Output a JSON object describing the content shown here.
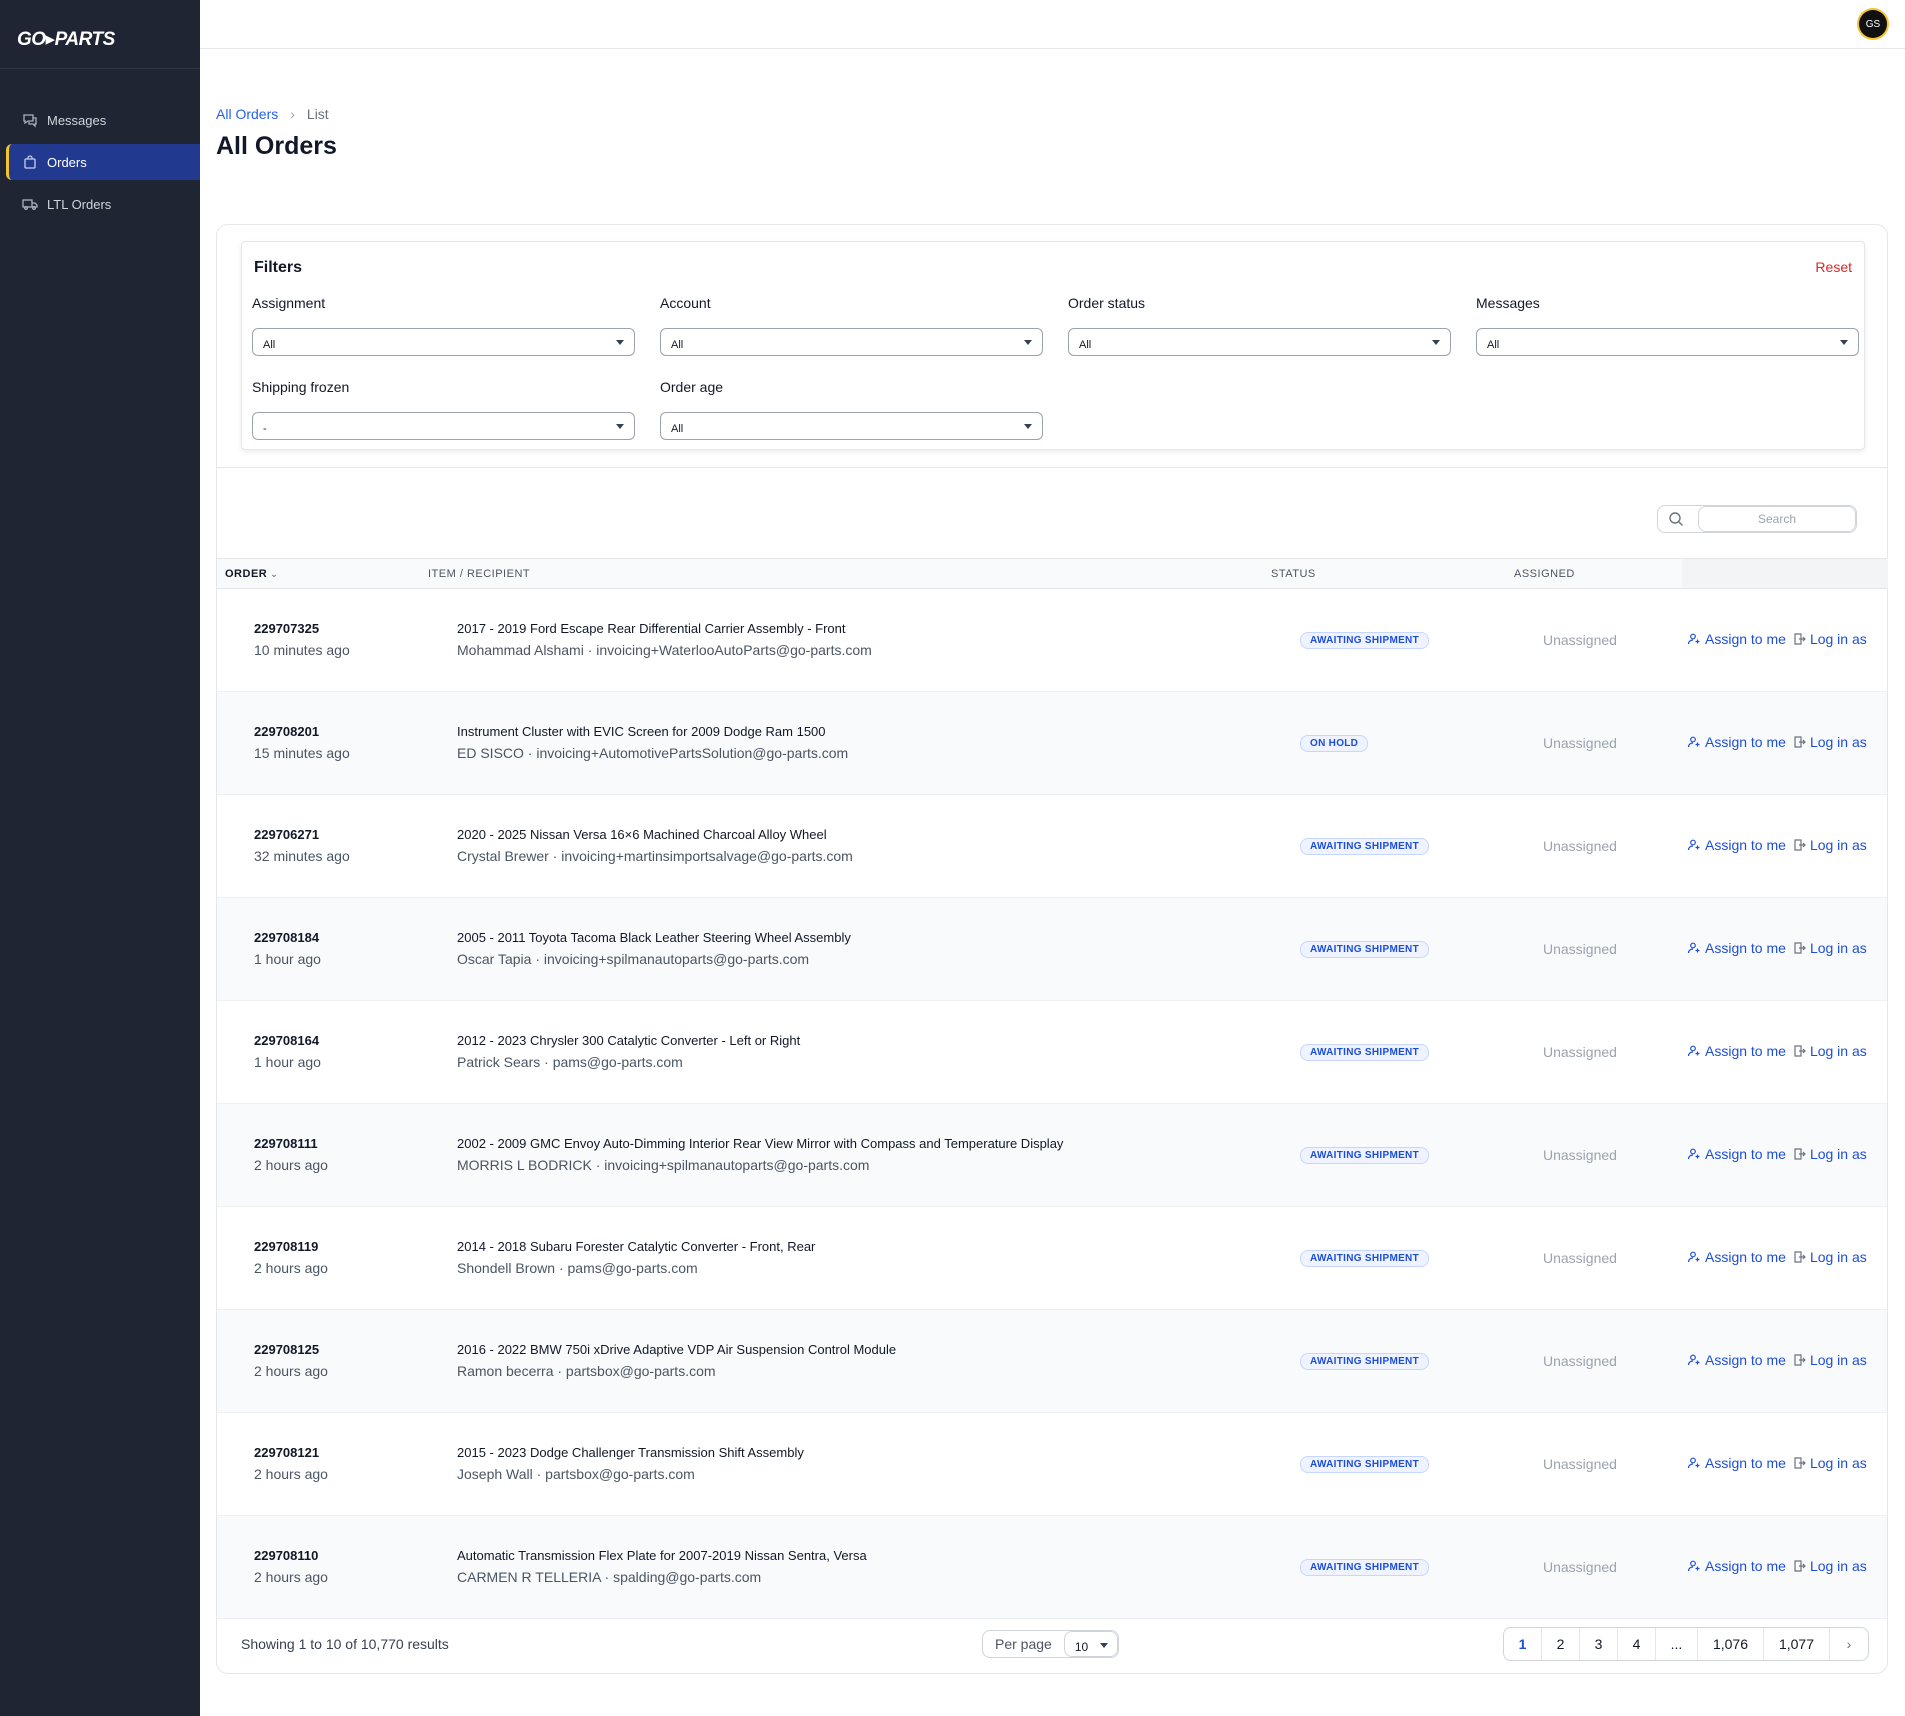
{
  "app": {
    "logo": "GO▸PARTS"
  },
  "sidebar": {
    "items": [
      {
        "label": "Messages",
        "icon": "chat-icon"
      },
      {
        "label": "Orders",
        "icon": "bag-icon",
        "active": true
      },
      {
        "label": "LTL Orders",
        "icon": "truck-icon"
      }
    ]
  },
  "user": {
    "initials": "GS"
  },
  "breadcrumb": {
    "parent": "All Orders",
    "current": "List"
  },
  "page": {
    "title": "All Orders"
  },
  "filters": {
    "title": "Filters",
    "reset": "Reset",
    "fields": [
      {
        "label": "Assignment",
        "value": "All"
      },
      {
        "label": "Account",
        "value": "All"
      },
      {
        "label": "Order status",
        "value": "All"
      },
      {
        "label": "Messages",
        "value": "All"
      },
      {
        "label": "Shipping frozen",
        "value": "-"
      },
      {
        "label": "Order age",
        "value": "All"
      }
    ]
  },
  "search": {
    "placeholder": "Search"
  },
  "table": {
    "columns": [
      "Order",
      "Item / Recipient",
      "Status",
      "Assigned"
    ],
    "sort_indicator": "⌄",
    "action_assign": "Assign to me",
    "action_login": "Log in as",
    "rows": [
      {
        "order": "229707325",
        "time": "10 minutes ago",
        "item": "2017 - 2019 Ford Escape Rear Differential Carrier Assembly - Front",
        "recipient": "Mohammad Alshami · invoicing+WaterlooAutoParts@go-parts.com",
        "status": "AWAITING SHIPMENT",
        "assigned": "Unassigned"
      },
      {
        "order": "229708201",
        "time": "15 minutes ago",
        "item": "Instrument Cluster with EVIC Screen for 2009 Dodge Ram 1500",
        "recipient": "ED SISCO · invoicing+AutomotivePartsSolution@go-parts.com",
        "status": "ON HOLD",
        "assigned": "Unassigned"
      },
      {
        "order": "229706271",
        "time": "32 minutes ago",
        "item": "2020 - 2025 Nissan Versa 16×6 Machined Charcoal Alloy Wheel",
        "recipient": "Crystal Brewer · invoicing+martinsimportsalvage@go-parts.com",
        "status": "AWAITING SHIPMENT",
        "assigned": "Unassigned"
      },
      {
        "order": "229708184",
        "time": "1 hour ago",
        "item": "2005 - 2011 Toyota Tacoma Black Leather Steering Wheel Assembly",
        "recipient": "Oscar Tapia · invoicing+spilmanautoparts@go-parts.com",
        "status": "AWAITING SHIPMENT",
        "assigned": "Unassigned"
      },
      {
        "order": "229708164",
        "time": "1 hour ago",
        "item": "2012 - 2023 Chrysler 300 Catalytic Converter - Left or Right",
        "recipient": "Patrick Sears · pams@go-parts.com",
        "status": "AWAITING SHIPMENT",
        "assigned": "Unassigned"
      },
      {
        "order": "229708111",
        "time": "2 hours ago",
        "item": "2002 - 2009 GMC Envoy Auto-Dimming Interior Rear View Mirror with Compass and Temperature Display",
        "recipient": "MORRIS L BODRICK · invoicing+spilmanautoparts@go-parts.com",
        "status": "AWAITING SHIPMENT",
        "assigned": "Unassigned"
      },
      {
        "order": "229708119",
        "time": "2 hours ago",
        "item": "2014 - 2018 Subaru Forester Catalytic Converter - Front, Rear",
        "recipient": "Shondell Brown · pams@go-parts.com",
        "status": "AWAITING SHIPMENT",
        "assigned": "Unassigned"
      },
      {
        "order": "229708125",
        "time": "2 hours ago",
        "item": "2016 - 2022 BMW 750i xDrive Adaptive VDP Air Suspension Control Module",
        "recipient": "Ramon becerra · partsbox@go-parts.com",
        "status": "AWAITING SHIPMENT",
        "assigned": "Unassigned"
      },
      {
        "order": "229708121",
        "time": "2 hours ago",
        "item": "2015 - 2023 Dodge Challenger Transmission Shift Assembly",
        "recipient": "Joseph Wall · partsbox@go-parts.com",
        "status": "AWAITING SHIPMENT",
        "assigned": "Unassigned"
      },
      {
        "order": "229708110",
        "time": "2 hours ago",
        "item": "Automatic Transmission Flex Plate for 2007-2019 Nissan Sentra, Versa",
        "recipient": "CARMEN R TELLERIA · spalding@go-parts.com",
        "status": "AWAITING SHIPMENT",
        "assigned": "Unassigned"
      }
    ]
  },
  "footer": {
    "summary": "Showing 1 to 10 of 10,770 results",
    "per_page_label": "Per page",
    "per_page_value": "10",
    "pages": [
      "1",
      "2",
      "3",
      "4",
      "...",
      "1,076",
      "1,077"
    ],
    "next": "›"
  },
  "colors": {
    "sidebar_bg": "#1f2532",
    "active_nav": "#213a8f",
    "accent_yellow": "#f4c430",
    "link_blue": "#2563eb",
    "reset_red": "#dc2626"
  }
}
